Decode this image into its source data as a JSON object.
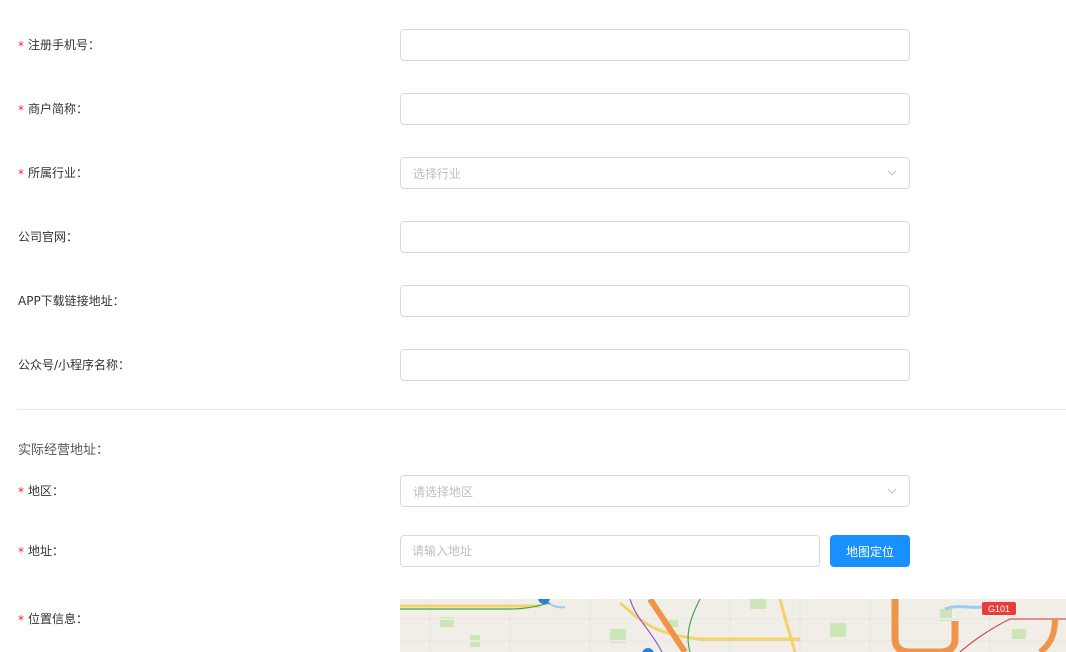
{
  "form": {
    "required_mark": "*",
    "fields": [
      {
        "label": "注册手机号：",
        "value": "",
        "placeholder": ""
      },
      {
        "label": "商户简称：",
        "value": "",
        "placeholder": ""
      },
      {
        "label": "所属行业：",
        "placeholder": "选择行业"
      },
      {
        "label": "公司官网：",
        "value": "",
        "placeholder": ""
      },
      {
        "label": "APP下载链接地址：",
        "value": "",
        "placeholder": ""
      },
      {
        "label": "公众号/小程序名称：",
        "value": "",
        "placeholder": ""
      }
    ]
  },
  "address_section": {
    "title": "实际经营地址：",
    "region": {
      "label": "地区：",
      "placeholder": "请选择地区"
    },
    "address": {
      "label": "地址：",
      "placeholder": "请输入地址",
      "button": "地图定位"
    },
    "location": {
      "label": "位置信息：",
      "road_badge": "G101"
    }
  },
  "colors": {
    "accent": "#1890ff",
    "required": "#f5222d",
    "border": "#d9d9d9",
    "placeholder": "#bfbfbf"
  }
}
